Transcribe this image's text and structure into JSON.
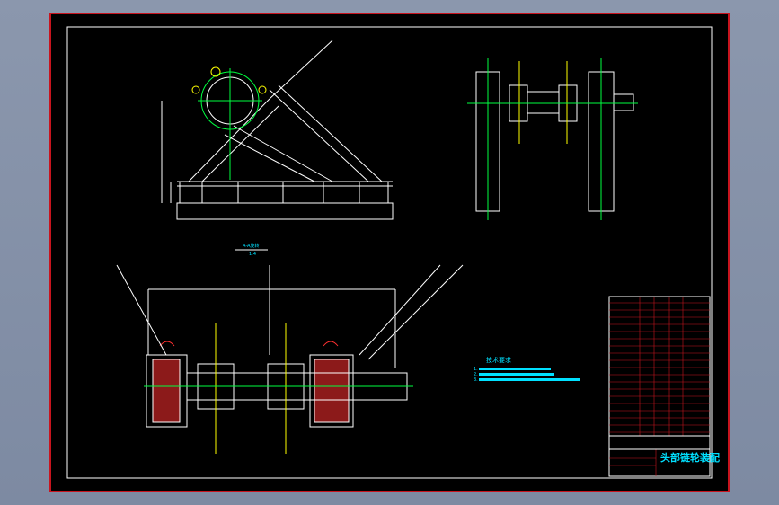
{
  "drawing": {
    "title": "头部链轮装配",
    "section_label": "A-A旋转",
    "section_scale": "1:4",
    "tech_requirements_heading": "技术要求",
    "tech_requirements": [
      "1.",
      "2.",
      "3."
    ]
  },
  "colors": {
    "frame_red": "#c8141e",
    "line_white": "#ffffff",
    "text_cyan": "#00e0ff",
    "center_green": "#00ff40",
    "part_yellow": "#ffff00",
    "section_red": "#ff3030"
  }
}
